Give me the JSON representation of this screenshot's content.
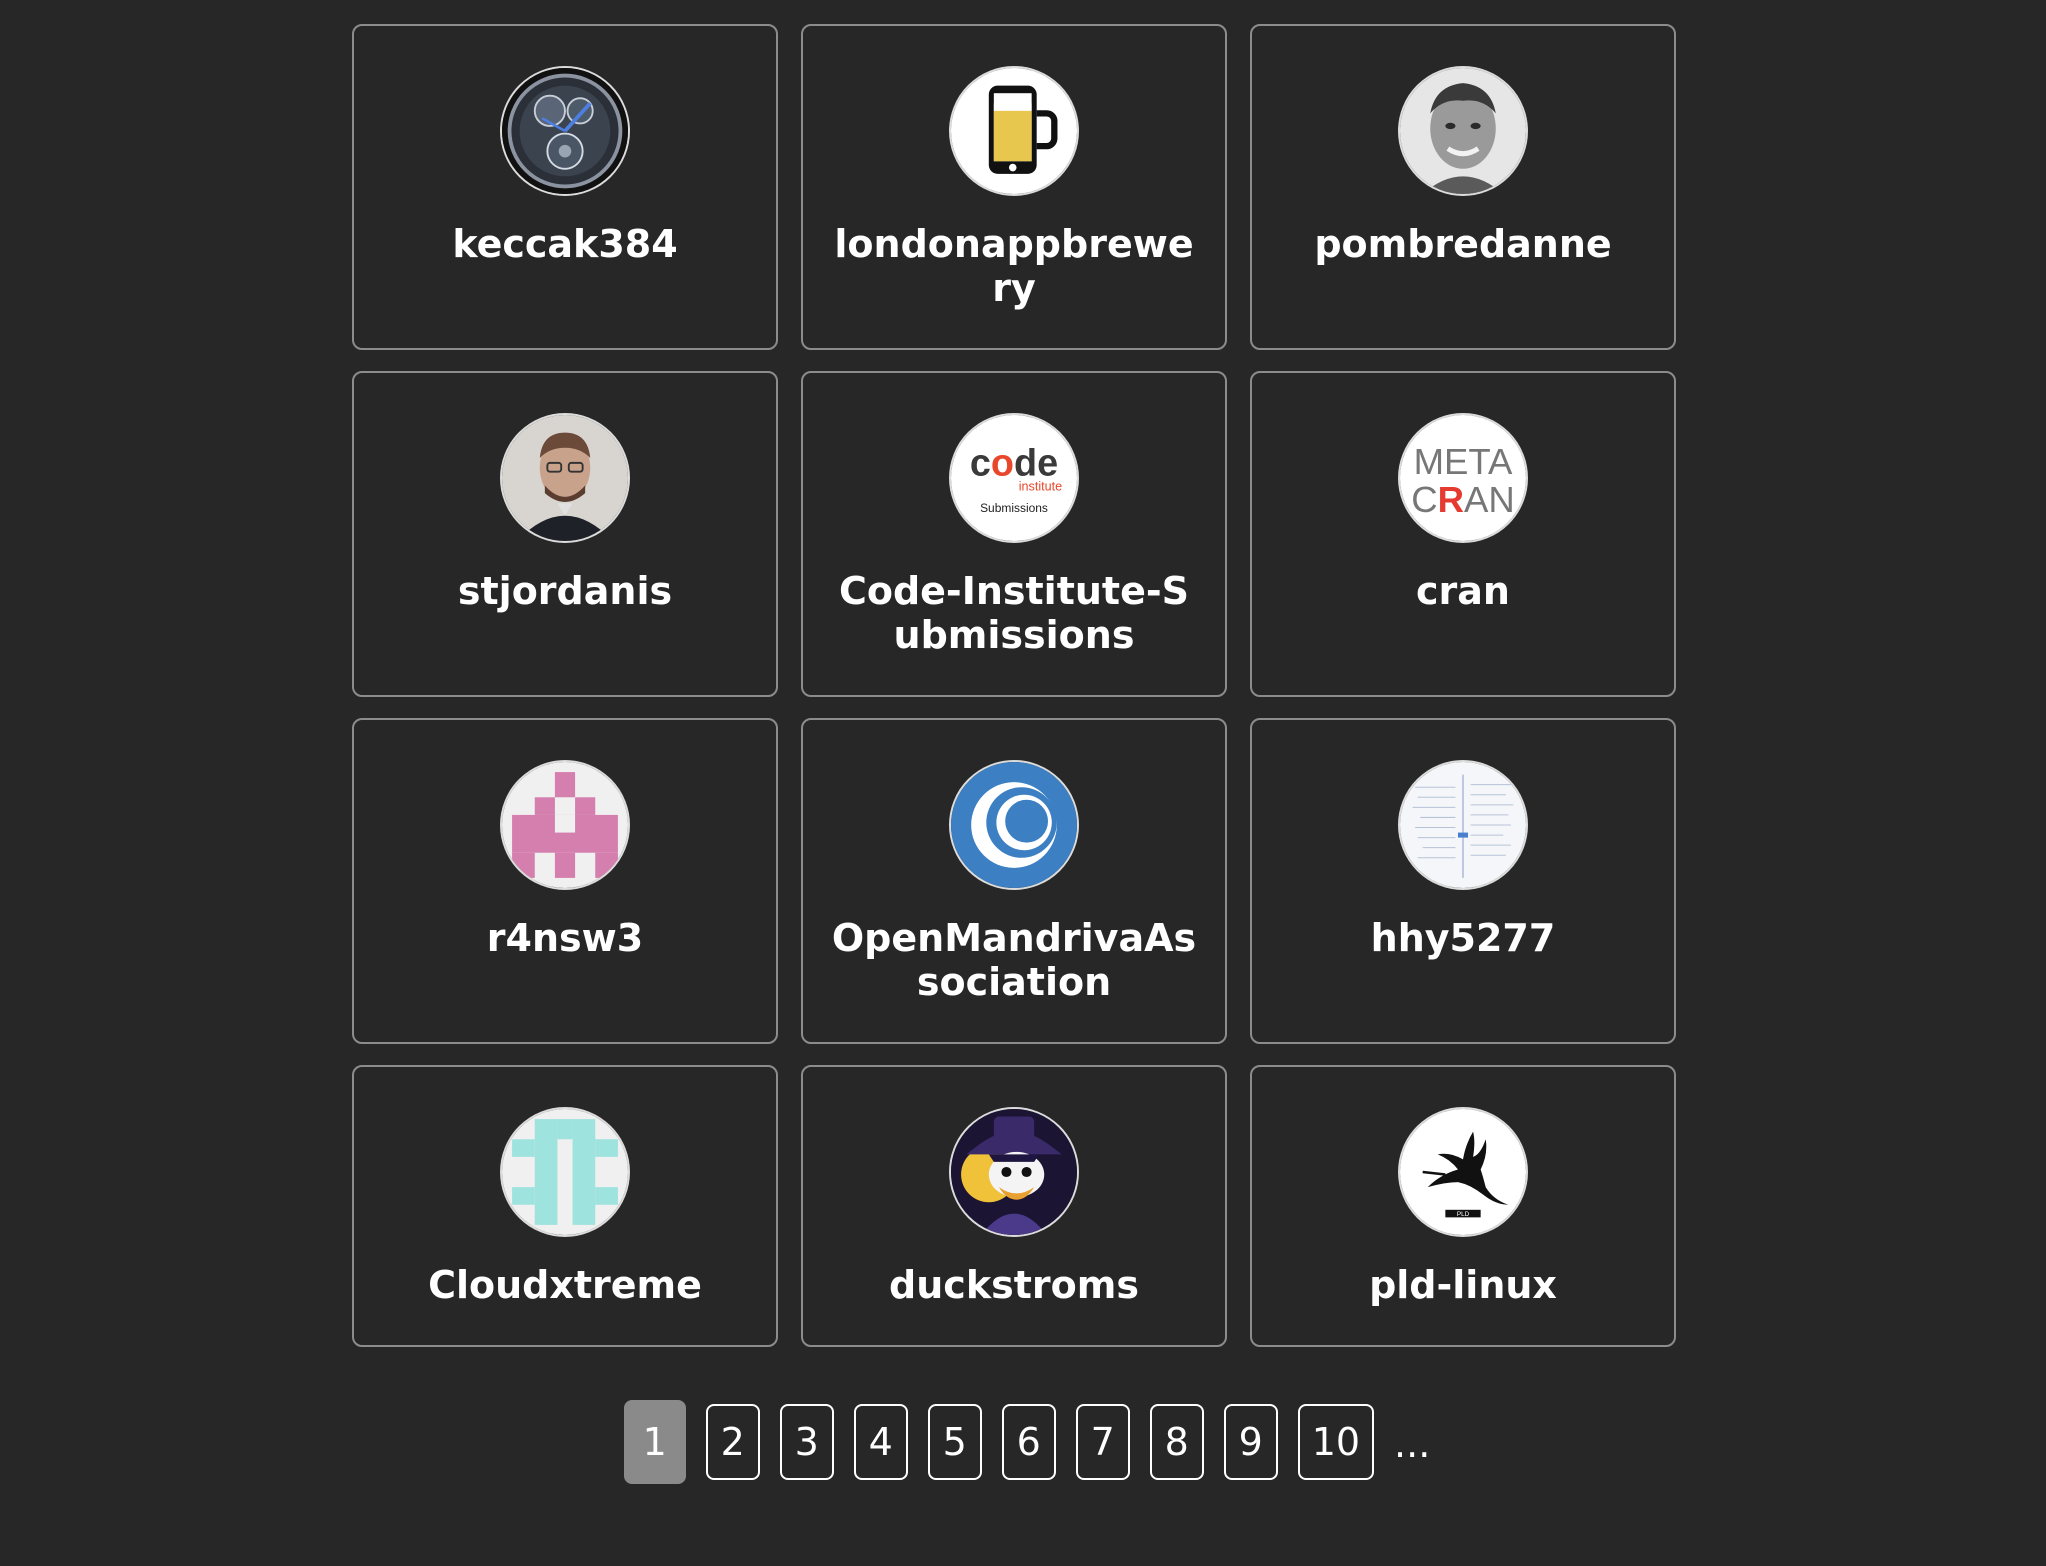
{
  "users": [
    {
      "name": "keccak384",
      "avatar": "watch-avatar-icon"
    },
    {
      "name": "londonappbrewery",
      "avatar": "beer-phone-avatar-icon"
    },
    {
      "name": "pombredanne",
      "avatar": "portrait-avatar-icon"
    },
    {
      "name": "stjordanis",
      "avatar": "portrait-avatar-icon"
    },
    {
      "name": "Code-Institute-Submissions",
      "avatar": "code-institute-logo-icon",
      "logo": {
        "word1": "c",
        "word2": "de",
        "sub": "institute",
        "caption": "Submissions"
      }
    },
    {
      "name": "cran",
      "avatar": "metacran-logo-icon",
      "logo": {
        "line1": "META",
        "line2a": "C",
        "line2b": "R",
        "line2c": "AN"
      }
    },
    {
      "name": "r4nsw3",
      "avatar": "identicon-avatar-icon"
    },
    {
      "name": "OpenMandrivaAssociation",
      "avatar": "openmandriva-logo-icon"
    },
    {
      "name": "hhy5277",
      "avatar": "mindmap-avatar-icon"
    },
    {
      "name": "Cloudxtreme",
      "avatar": "identicon-avatar-icon"
    },
    {
      "name": "duckstroms",
      "avatar": "duck-avatar-icon"
    },
    {
      "name": "pld-linux",
      "avatar": "stork-logo-icon",
      "logo": {
        "tag": "PLD"
      }
    }
  ],
  "pagination": {
    "pages": [
      "1",
      "2",
      "3",
      "4",
      "5",
      "6",
      "7",
      "8",
      "9",
      "10"
    ],
    "active": "1",
    "more": "..."
  },
  "colors": {
    "background": "#272727",
    "card_border": "#8c8c8c",
    "active_page": "#8a8a8a",
    "identicon_pink": "#d47fae",
    "identicon_teal": "#9fe3df",
    "openmandriva_blue": "#3c7fc3",
    "cran_red": "#e53a2f"
  }
}
